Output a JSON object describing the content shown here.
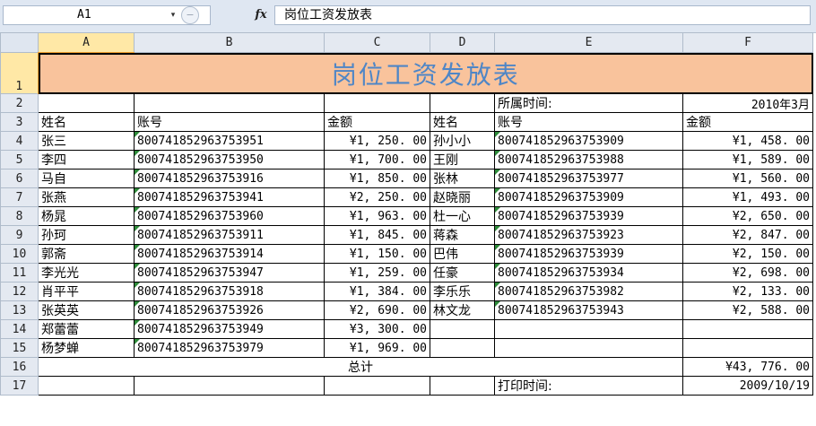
{
  "formula_bar": {
    "cell_ref": "A1",
    "dropdown_glyph": "▾",
    "cancel_glyph": "−",
    "fx_label": "fx",
    "formula": "岗位工资发放表"
  },
  "columns": [
    "A",
    "B",
    "C",
    "D",
    "E",
    "F"
  ],
  "rows": [
    1,
    2,
    3,
    4,
    5,
    6,
    7,
    8,
    9,
    10,
    11,
    12,
    13,
    14,
    15,
    16,
    17
  ],
  "sheet": {
    "title": "岗位工资发放表",
    "period_label": "所属时间:",
    "period_value": "2010年3月",
    "headers": {
      "name": "姓名",
      "account": "账号",
      "amount": "金额"
    },
    "left": [
      {
        "name": "张三",
        "account": "800741852963753951",
        "amount": "¥1, 250. 00"
      },
      {
        "name": "李四",
        "account": "800741852963753950",
        "amount": "¥1, 700. 00"
      },
      {
        "name": "马自",
        "account": "800741852963753916",
        "amount": "¥1, 850. 00"
      },
      {
        "name": "张燕",
        "account": "800741852963753941",
        "amount": "¥2, 250. 00"
      },
      {
        "name": "杨晁",
        "account": "800741852963753960",
        "amount": "¥1, 963. 00"
      },
      {
        "name": "孙珂",
        "account": "800741852963753911",
        "amount": "¥1, 845. 00"
      },
      {
        "name": "郭斋",
        "account": "800741852963753914",
        "amount": "¥1, 150. 00"
      },
      {
        "name": "李光光",
        "account": "800741852963753947",
        "amount": "¥1, 259. 00"
      },
      {
        "name": "肖平平",
        "account": "800741852963753918",
        "amount": "¥1, 384. 00"
      },
      {
        "name": "张英英",
        "account": "800741852963753926",
        "amount": "¥2, 690. 00"
      },
      {
        "name": "郑蕾蕾",
        "account": "800741852963753949",
        "amount": "¥3, 300. 00"
      },
      {
        "name": "杨梦蝉",
        "account": "800741852963753979",
        "amount": "¥1, 969. 00"
      }
    ],
    "right": [
      {
        "name": "孙小小",
        "account": "800741852963753909",
        "amount": "¥1, 458. 00"
      },
      {
        "name": "王刚",
        "account": "800741852963753988",
        "amount": "¥1, 589. 00"
      },
      {
        "name": "张林",
        "account": "800741852963753977",
        "amount": "¥1, 560. 00"
      },
      {
        "name": "赵晓丽",
        "account": "800741852963753909",
        "amount": "¥1, 493. 00"
      },
      {
        "name": "杜一心",
        "account": "800741852963753939",
        "amount": "¥2, 650. 00"
      },
      {
        "name": "蒋森",
        "account": "800741852963753923",
        "amount": "¥2, 847. 00"
      },
      {
        "name": "巴伟",
        "account": "800741852963753939",
        "amount": "¥2, 150. 00"
      },
      {
        "name": "任豪",
        "account": "800741852963753934",
        "amount": "¥2, 698. 00"
      },
      {
        "name": "李乐乐",
        "account": "800741852963753982",
        "amount": "¥2, 133. 00"
      },
      {
        "name": "林文龙",
        "account": "800741852963753943",
        "amount": "¥2, 588. 00"
      }
    ],
    "total_label": "总计",
    "total_value": "¥43, 776. 00",
    "print_label": "打印时间:",
    "print_value": "2009/10/19"
  },
  "colors": {
    "title_fill": "#f9c39c",
    "title_text": "#4f86c6",
    "selection": "#ffe8a6"
  }
}
